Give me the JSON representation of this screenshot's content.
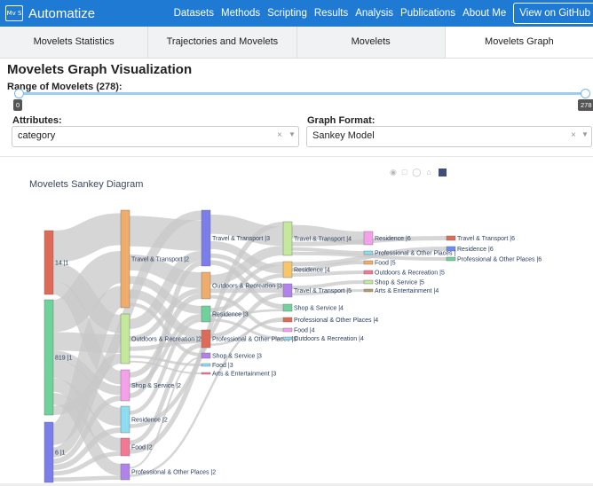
{
  "navbar": {
    "brand_logo_text": "Mv S",
    "brand": "Automatize",
    "links": [
      "Datasets",
      "Methods",
      "Scripting",
      "Results",
      "Analysis",
      "Publications",
      "About Me"
    ],
    "github_button": "View on GitHub"
  },
  "tabs": [
    {
      "label": "Movelets Statistics",
      "active": false
    },
    {
      "label": "Trajectories and Movelets",
      "active": false
    },
    {
      "label": "Movelets",
      "active": false
    },
    {
      "label": "Movelets Graph",
      "active": true
    }
  ],
  "page_title": "Movelets Graph Visualization",
  "range": {
    "label": "Range of Movelets (278):",
    "min": "0",
    "max": "278"
  },
  "attributes": {
    "label": "Attributes:",
    "value": "category",
    "clear": "×",
    "caret": "▼"
  },
  "graph_format": {
    "label": "Graph Format:",
    "value": "Sankey Model",
    "clear": "×",
    "caret": "▼"
  },
  "toolbar_icons": [
    "camera-icon",
    "box-select-icon",
    "lasso-icon",
    "home-icon",
    "plotly-logo-icon"
  ],
  "colors": {
    "navbar": "#1f7ad4",
    "link_gray": "#c8c8c8"
  },
  "chart_data": {
    "type": "sankey",
    "title": "Movelets Sankey Diagram",
    "nodes": [
      {
        "label": "14 |1",
        "color": "#e06a58",
        "value": 14
      },
      {
        "label": "819 |1",
        "color": "#6dd39a",
        "value": 28
      },
      {
        "label": "6 |1",
        "color": "#7b7dea",
        "value": 13
      },
      {
        "label": "Travel & Transport |2",
        "color": "#f0ac6a",
        "value": 20
      },
      {
        "label": "Outdoors & Recreation |2",
        "color": "#c4e89c",
        "value": 10
      },
      {
        "label": "Shop & Service |2",
        "color": "#f3a2ea",
        "value": 6
      },
      {
        "label": "Residence |2",
        "color": "#8ddcf0",
        "value": 5
      },
      {
        "label": "Food |2",
        "color": "#f37896",
        "value": 4
      },
      {
        "label": "Professional & Other Places |2",
        "color": "#b183ea",
        "value": 3
      },
      {
        "label": "Travel & Transport |3",
        "color": "#7b7dea",
        "value": 10
      },
      {
        "label": "Outdoors & Recreation |3",
        "color": "#f0ac6a",
        "value": 5
      },
      {
        "label": "Residence |3",
        "color": "#6dd39a",
        "value": 3
      },
      {
        "label": "Professional & Other Places |3",
        "color": "#e06a58",
        "value": 3
      },
      {
        "label": "Shop & Service |3",
        "color": "#b183ea",
        "value": 1
      },
      {
        "label": "Food |3",
        "color": "#8ddcf0",
        "value": 0.6
      },
      {
        "label": "Arts & Entertainment |3",
        "color": "#f37896",
        "value": 0.4
      },
      {
        "label": "Travel & Transport |4",
        "color": "#c4e89c",
        "value": 6
      },
      {
        "label": "Residence |4",
        "color": "#f7c66a",
        "value": 3
      },
      {
        "label": "Travel & Transport |5",
        "color": "#b183ea",
        "value": 2
      },
      {
        "label": "Shop & Service |4",
        "color": "#6dd39a",
        "value": 1
      },
      {
        "label": "Professional & Other Places |4",
        "color": "#e06a58",
        "value": 0.8
      },
      {
        "label": "Food |4",
        "color": "#f3a2ea",
        "value": 0.6
      },
      {
        "label": "Outdoors & Recreation |4",
        "color": "#8ddcf0",
        "value": 0.5
      },
      {
        "label": "Residence |6",
        "color": "#f3a2ea",
        "value": 2
      },
      {
        "label": "Travel & Transport |6",
        "color": "#e06a58",
        "value": 0.5
      },
      {
        "label": "Residence |6",
        "color": "#6d8bf0",
        "value": 0.4
      },
      {
        "label": "Professional & Other Places |",
        "color": "#8ddcf0",
        "value": 0.5
      },
      {
        "label": "Professional & Other Places |6",
        "color": "#6dd39a",
        "value": 0.4
      },
      {
        "label": "Food |5",
        "color": "#f0ac6a",
        "value": 0.4
      },
      {
        "label": "Outdoors & Recreation |5",
        "color": "#f37896",
        "value": 0.4
      },
      {
        "label": "Shop & Service |5",
        "color": "#c4e89c",
        "value": 0.4
      },
      {
        "label": "Arts & Entertainment |4",
        "color": "#b59a6a",
        "value": 0.3
      }
    ],
    "links": [
      [
        0,
        3,
        7
      ],
      [
        0,
        4,
        4
      ],
      [
        0,
        5,
        3
      ],
      [
        1,
        3,
        7
      ],
      [
        1,
        4,
        4
      ],
      [
        1,
        5,
        2
      ],
      [
        1,
        6,
        4
      ],
      [
        1,
        7,
        3
      ],
      [
        1,
        8,
        3
      ],
      [
        1,
        9,
        2
      ],
      [
        2,
        3,
        4
      ],
      [
        2,
        4,
        2
      ],
      [
        2,
        5,
        1
      ],
      [
        2,
        6,
        1
      ],
      [
        2,
        7,
        1
      ],
      [
        2,
        8,
        1
      ],
      [
        3,
        9,
        6
      ],
      [
        3,
        10,
        3
      ],
      [
        3,
        11,
        2
      ],
      [
        3,
        12,
        2
      ],
      [
        3,
        13,
        1
      ],
      [
        4,
        9,
        2
      ],
      [
        4,
        10,
        1
      ],
      [
        4,
        12,
        1
      ],
      [
        4,
        14,
        0.6
      ],
      [
        4,
        15,
        0.4
      ],
      [
        5,
        10,
        1
      ],
      [
        5,
        11,
        1
      ],
      [
        5,
        9,
        1
      ],
      [
        6,
        11,
        1
      ],
      [
        6,
        17,
        1
      ],
      [
        7,
        12,
        1
      ],
      [
        7,
        16,
        1
      ],
      [
        8,
        13,
        0.5
      ],
      [
        8,
        20,
        0.5
      ],
      [
        9,
        16,
        4
      ],
      [
        9,
        17,
        2
      ],
      [
        9,
        18,
        1
      ],
      [
        9,
        19,
        1
      ],
      [
        10,
        16,
        2
      ],
      [
        10,
        18,
        1
      ],
      [
        10,
        21,
        0.6
      ],
      [
        11,
        17,
        1
      ],
      [
        11,
        19,
        0.5
      ],
      [
        11,
        22,
        0.5
      ],
      [
        12,
        18,
        1
      ],
      [
        12,
        20,
        0.5
      ],
      [
        16,
        23,
        2
      ],
      [
        16,
        24,
        0.5
      ],
      [
        16,
        26,
        0.5
      ],
      [
        16,
        27,
        0.4
      ],
      [
        17,
        25,
        0.4
      ],
      [
        17,
        28,
        0.4
      ],
      [
        17,
        29,
        0.4
      ],
      [
        18,
        30,
        0.4
      ],
      [
        18,
        31,
        0.3
      ]
    ]
  }
}
